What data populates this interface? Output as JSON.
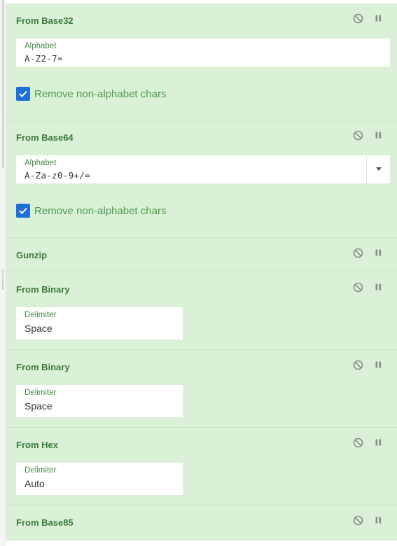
{
  "operations": [
    {
      "title": "From Base32",
      "field": {
        "label": "Alphabet",
        "value": "A-Z2-7="
      },
      "checkbox": {
        "label": "Remove non-alphabet chars",
        "checked": true
      }
    },
    {
      "title": "From Base64",
      "field": {
        "label": "Alphabet",
        "value": "A-Za-z0-9+/="
      },
      "checkbox": {
        "label": "Remove non-alphabet chars",
        "checked": true
      }
    },
    {
      "title": "Gunzip"
    },
    {
      "title": "From Binary",
      "field": {
        "label": "Delimiter",
        "value": "Space"
      }
    },
    {
      "title": "From Binary",
      "field": {
        "label": "Delimiter",
        "value": "Space"
      }
    },
    {
      "title": "From Hex",
      "field": {
        "label": "Delimiter",
        "value": "Auto"
      }
    },
    {
      "title": "From Base85"
    }
  ],
  "icons": {
    "disable": "disable-icon",
    "breakpoint": "pause-icon"
  },
  "colors": {
    "op_background": "#dbf1d7",
    "title": "#3b7a3b",
    "checkbox": "#1e6fd9"
  }
}
